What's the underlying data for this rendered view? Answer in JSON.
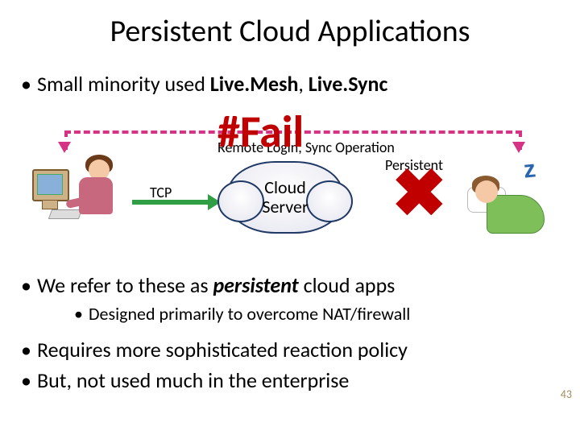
{
  "title": "Persistent Cloud Applications",
  "bullets": {
    "b1_pre": "Small minority used ",
    "b1_em1": "Live.Mesh",
    "b1_mid": ", ",
    "b1_em2": "Live.Sync",
    "b2_pre": "We refer to these as ",
    "b2_em": "persistent",
    "b2_post": " cloud apps",
    "sub2": "Designed primarily to overcome NAT/firewall",
    "b3": "Requires more sophisticated reaction policy",
    "b4": "But, not used much in the enterprise"
  },
  "diagram": {
    "fail": "#Fail",
    "operation": "Remote Login, Sync Operation",
    "persistent": "Persistent",
    "tcp": "TCP",
    "cloud_line1": "Cloud",
    "cloud_line2": "Server",
    "x": "✖",
    "zzz": "z"
  },
  "page_number": "43"
}
